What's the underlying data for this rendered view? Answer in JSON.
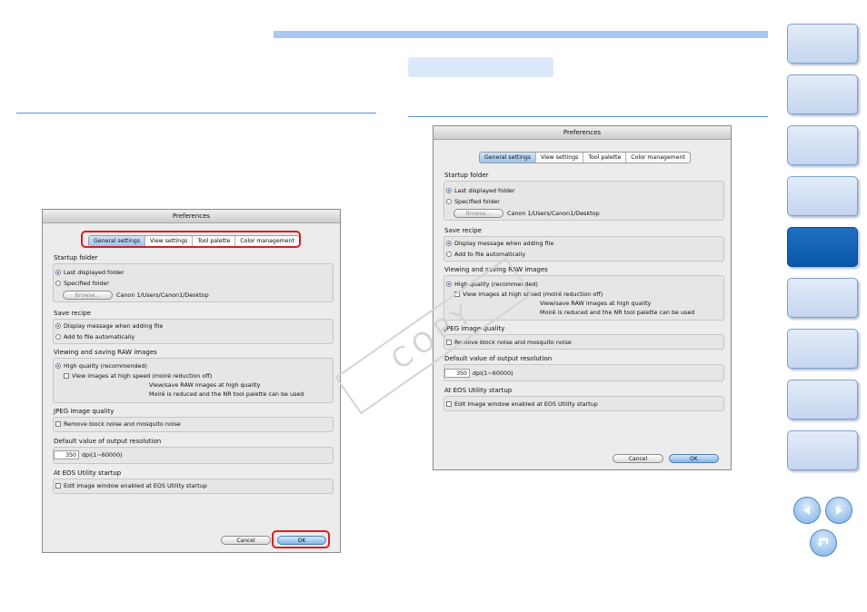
{
  "watermark": "COPY",
  "dialog": {
    "title": "Preferences",
    "tabs": [
      "General settings",
      "View settings",
      "Tool palette",
      "Color management"
    ],
    "startup_folder": {
      "label": "Startup folder",
      "last_displayed": "Last displayed folder",
      "specified": "Specified folder",
      "browse": "Browse...",
      "path": "Canon 1/Users/Canon1/Desktop"
    },
    "save_recipe": {
      "label": "Save recipe",
      "display_message": "Display message when adding file",
      "add_auto": "Add to file automatically"
    },
    "raw": {
      "label": "Viewing and saving RAW images",
      "high_quality": "High quality (recommended)",
      "high_speed": "View images at high speed (moiré reduction off)",
      "note1": "View/save RAW images at high quality",
      "note2": "Moiré is reduced and the NR tool palette can be used"
    },
    "jpeg": {
      "label": "JPEG image quality",
      "remove_noise": "Remove block noise and mosquito noise"
    },
    "resolution": {
      "label": "Default value of output resolution",
      "value": "350",
      "unit": "dpi(1~60000)"
    },
    "eos": {
      "label": "At EOS Utility startup",
      "edit_window": "Edit image window enabled at EOS Utility startup"
    },
    "cancel": "Cancel",
    "ok": "OK"
  },
  "nav": {
    "buttons": 9,
    "active_index": 5
  }
}
